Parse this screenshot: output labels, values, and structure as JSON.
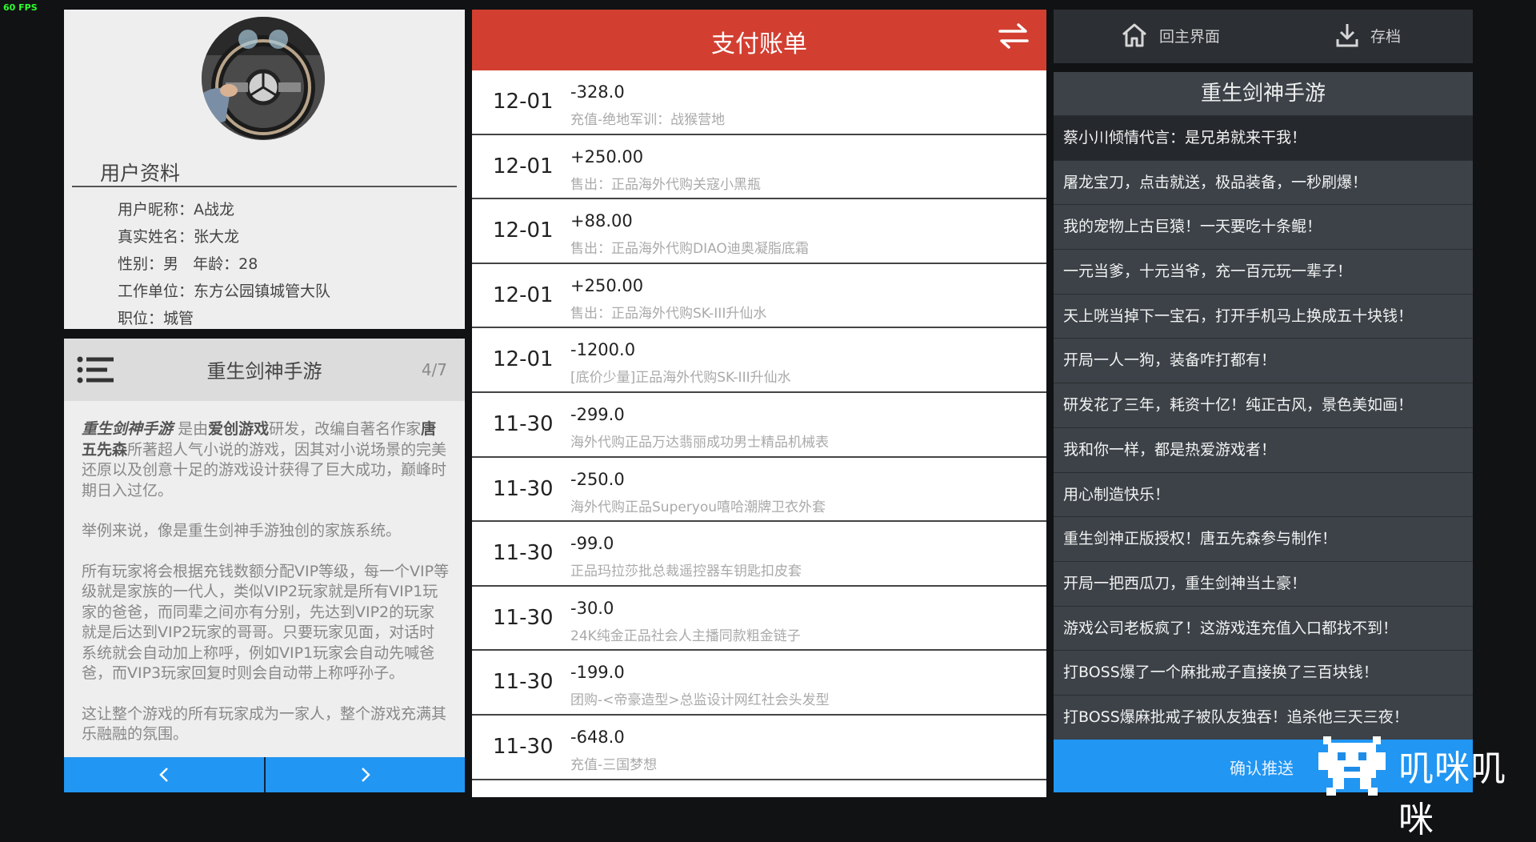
{
  "fps": "60 FPS",
  "profile": {
    "avatar_icon": "steering-wheel-photo",
    "title": "用户资料",
    "fields": [
      {
        "text": "用户昵称：A战龙"
      },
      {
        "text": "真实姓名：张大龙"
      },
      {
        "text": "性别：男   年龄：28"
      },
      {
        "text": "工作单位：东方公园镇城管大队"
      },
      {
        "text": "职位：城管"
      }
    ]
  },
  "game_panel": {
    "title": "重生剑神手游",
    "page": "4/7",
    "intro": {
      "game_name": "重生剑神手游",
      "t1": "是由",
      "studio": "爱创游戏",
      "t2": "研发，改编自著名作家",
      "author": "唐五先森",
      "t3": "所著超人气小说的游戏，因其对小说场景的完美还原以及创意十足的游戏设计获得了巨大成功，巅峰时期日入过亿。"
    },
    "paragraphs": [
      "举例来说，像是重生剑神手游独创的家族系统。",
      "所有玩家将会根据充钱数额分配VIP等级，每一个VIP等级就是家族的一代人，类似VIP2玩家就是所有VIP1玩家的爸爸，而同辈之间亦有分别，先达到VIP2的玩家就是后达到VIP2玩家的哥哥。只要玩家见面，对话时系统就会自动加上称呼，例如VIP1玩家会自动先喊爸爸，而VIP3玩家回复时则会自动带上称呼孙子。",
      "这让整个游戏的所有玩家成为一家人，整个游戏充满其乐融融的氛围。"
    ],
    "prev_icon": "chevron-left-icon",
    "next_icon": "chevron-right-icon"
  },
  "bill": {
    "title": "支付账单",
    "swap_icon": "swap-arrows-icon",
    "rows": [
      {
        "date": "12-01",
        "amount": "-328.0",
        "desc": "充值-绝地军训：战猴营地"
      },
      {
        "date": "12-01",
        "amount": "+250.00",
        "desc": "售出：正品海外代购关寇小黑瓶"
      },
      {
        "date": "12-01",
        "amount": "+88.00",
        "desc": "售出：正品海外代购DIAO迪奥凝脂底霜"
      },
      {
        "date": "12-01",
        "amount": "+250.00",
        "desc": "售出：正品海外代购SK-III升仙水"
      },
      {
        "date": "12-01",
        "amount": "-1200.0",
        "desc": "[底价少量]正品海外代购SK-III升仙水"
      },
      {
        "date": "11-30",
        "amount": "-299.0",
        "desc": "海外代购正品万达翡丽成功男士精品机械表"
      },
      {
        "date": "11-30",
        "amount": "-250.0",
        "desc": "海外代购正品Superyou嘻哈潮牌卫衣外套"
      },
      {
        "date": "11-30",
        "amount": "-99.0",
        "desc": "正品玛拉莎批总裁遥控器车钥匙扣皮套"
      },
      {
        "date": "11-30",
        "amount": "-30.0",
        "desc": "24K纯金正品社会人主播同款粗金链子"
      },
      {
        "date": "11-30",
        "amount": "-199.0",
        "desc": "团购-<帝豪造型>总监设计网红社会头发型"
      },
      {
        "date": "11-30",
        "amount": "-648.0",
        "desc": "充值-三国梦想"
      }
    ]
  },
  "topbar": {
    "home_label": "回主界面",
    "home_icon": "home-icon",
    "save_label": "存档",
    "save_icon": "download-icon"
  },
  "push_panel": {
    "title": "重生剑神手游",
    "items": [
      "蔡小川倾情代言：是兄弟就来干我！",
      "屠龙宝刀，点击就送，极品装备，一秒刷爆！",
      "我的宠物上古巨猿！一天要吃十条鲲！",
      "一元当爹，十元当爷，充一百元玩一辈子！",
      "天上咣当掉下一宝石，打开手机马上换成五十块钱！",
      "开局一人一狗，装备咋打都有！",
      "研发花了三年，耗资十亿！纯正古风，景色美如画！",
      "我和你一样，都是热爱游戏者！",
      "用心制造快乐！",
      "重生剑神正版授权！唐五先森参与制作！",
      "开局一把西瓜刀，重生剑神当土豪！",
      "游戏公司老板疯了！这游戏连充值入口都找不到！",
      "打BOSS爆了一个麻批戒子直接换了三百块钱！",
      "打BOSS爆麻批戒子被队友独吞！追杀他三天三夜！"
    ],
    "confirm_label": "确认推送"
  },
  "watermark": {
    "text": "叽咪叽咪",
    "icon": "pixel-robot-logo-icon"
  }
}
